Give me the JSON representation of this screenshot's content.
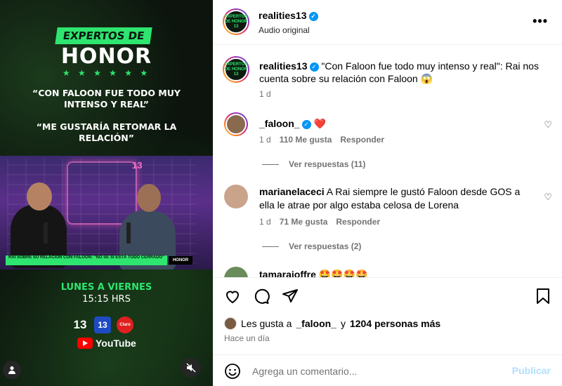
{
  "media": {
    "badge": "EXPERTOS DE",
    "title": "HONOR",
    "stars": "★ ★ ★ ★ ★ ★",
    "quote1": "“CON FALOON FUE TODO MUY INTENSO Y REAL”",
    "quote2": "“ME GUSTARÍA RETOMAR LA RELACIÓN”",
    "lower_third": "RAI SOBRE SU RELACIÓN CON FALOON: \"NO SÉ SI ESTÁ TODO CERRADO\"",
    "lower_logo": "HONOR",
    "neon_number": "13",
    "days": "LUNES A VIERNES",
    "time": "15:15 HRS",
    "channel_logos": [
      "13",
      "13",
      "Claro"
    ],
    "youtube": "YouTube"
  },
  "header": {
    "username": "realities13",
    "audio": "Audio original",
    "avatar_text": "EXPERTOS DE HONOR 13"
  },
  "caption": {
    "username": "realities13",
    "text": "\"Con Faloon fue todo muy intenso y real\": Rai nos cuenta sobre su relación con Faloon 😱",
    "time": "1 d"
  },
  "comments": [
    {
      "username": "_faloon_",
      "text": "❤️",
      "time": "1 d",
      "likes": "110 Me gusta",
      "reply": "Responder",
      "view_replies": "Ver respuestas (11)"
    },
    {
      "username": "marianelaceci",
      "text": "A Rai siempre le gustó Faloon desde GOS a ella le atrae por algo estaba celosa de Lorena",
      "time": "1 d",
      "likes": "71 Me gusta",
      "reply": "Responder",
      "view_replies": "Ver respuestas (2)"
    },
    {
      "username": "tamarajoffre",
      "text": "🤩🤩🤩🤩"
    }
  ],
  "likes": {
    "prefix": "Les gusta a",
    "user": "_faloon_",
    "mid": "y",
    "count": "1204 personas más"
  },
  "ago": "Hace un día",
  "composer": {
    "placeholder": "Agrega un comentario...",
    "publish": "Publicar"
  },
  "colors": {
    "accent_green": "#2ee56f",
    "verified_blue": "#0095f6",
    "publish_disabled": "#b2dffc",
    "heart_red": "#ed4956"
  }
}
